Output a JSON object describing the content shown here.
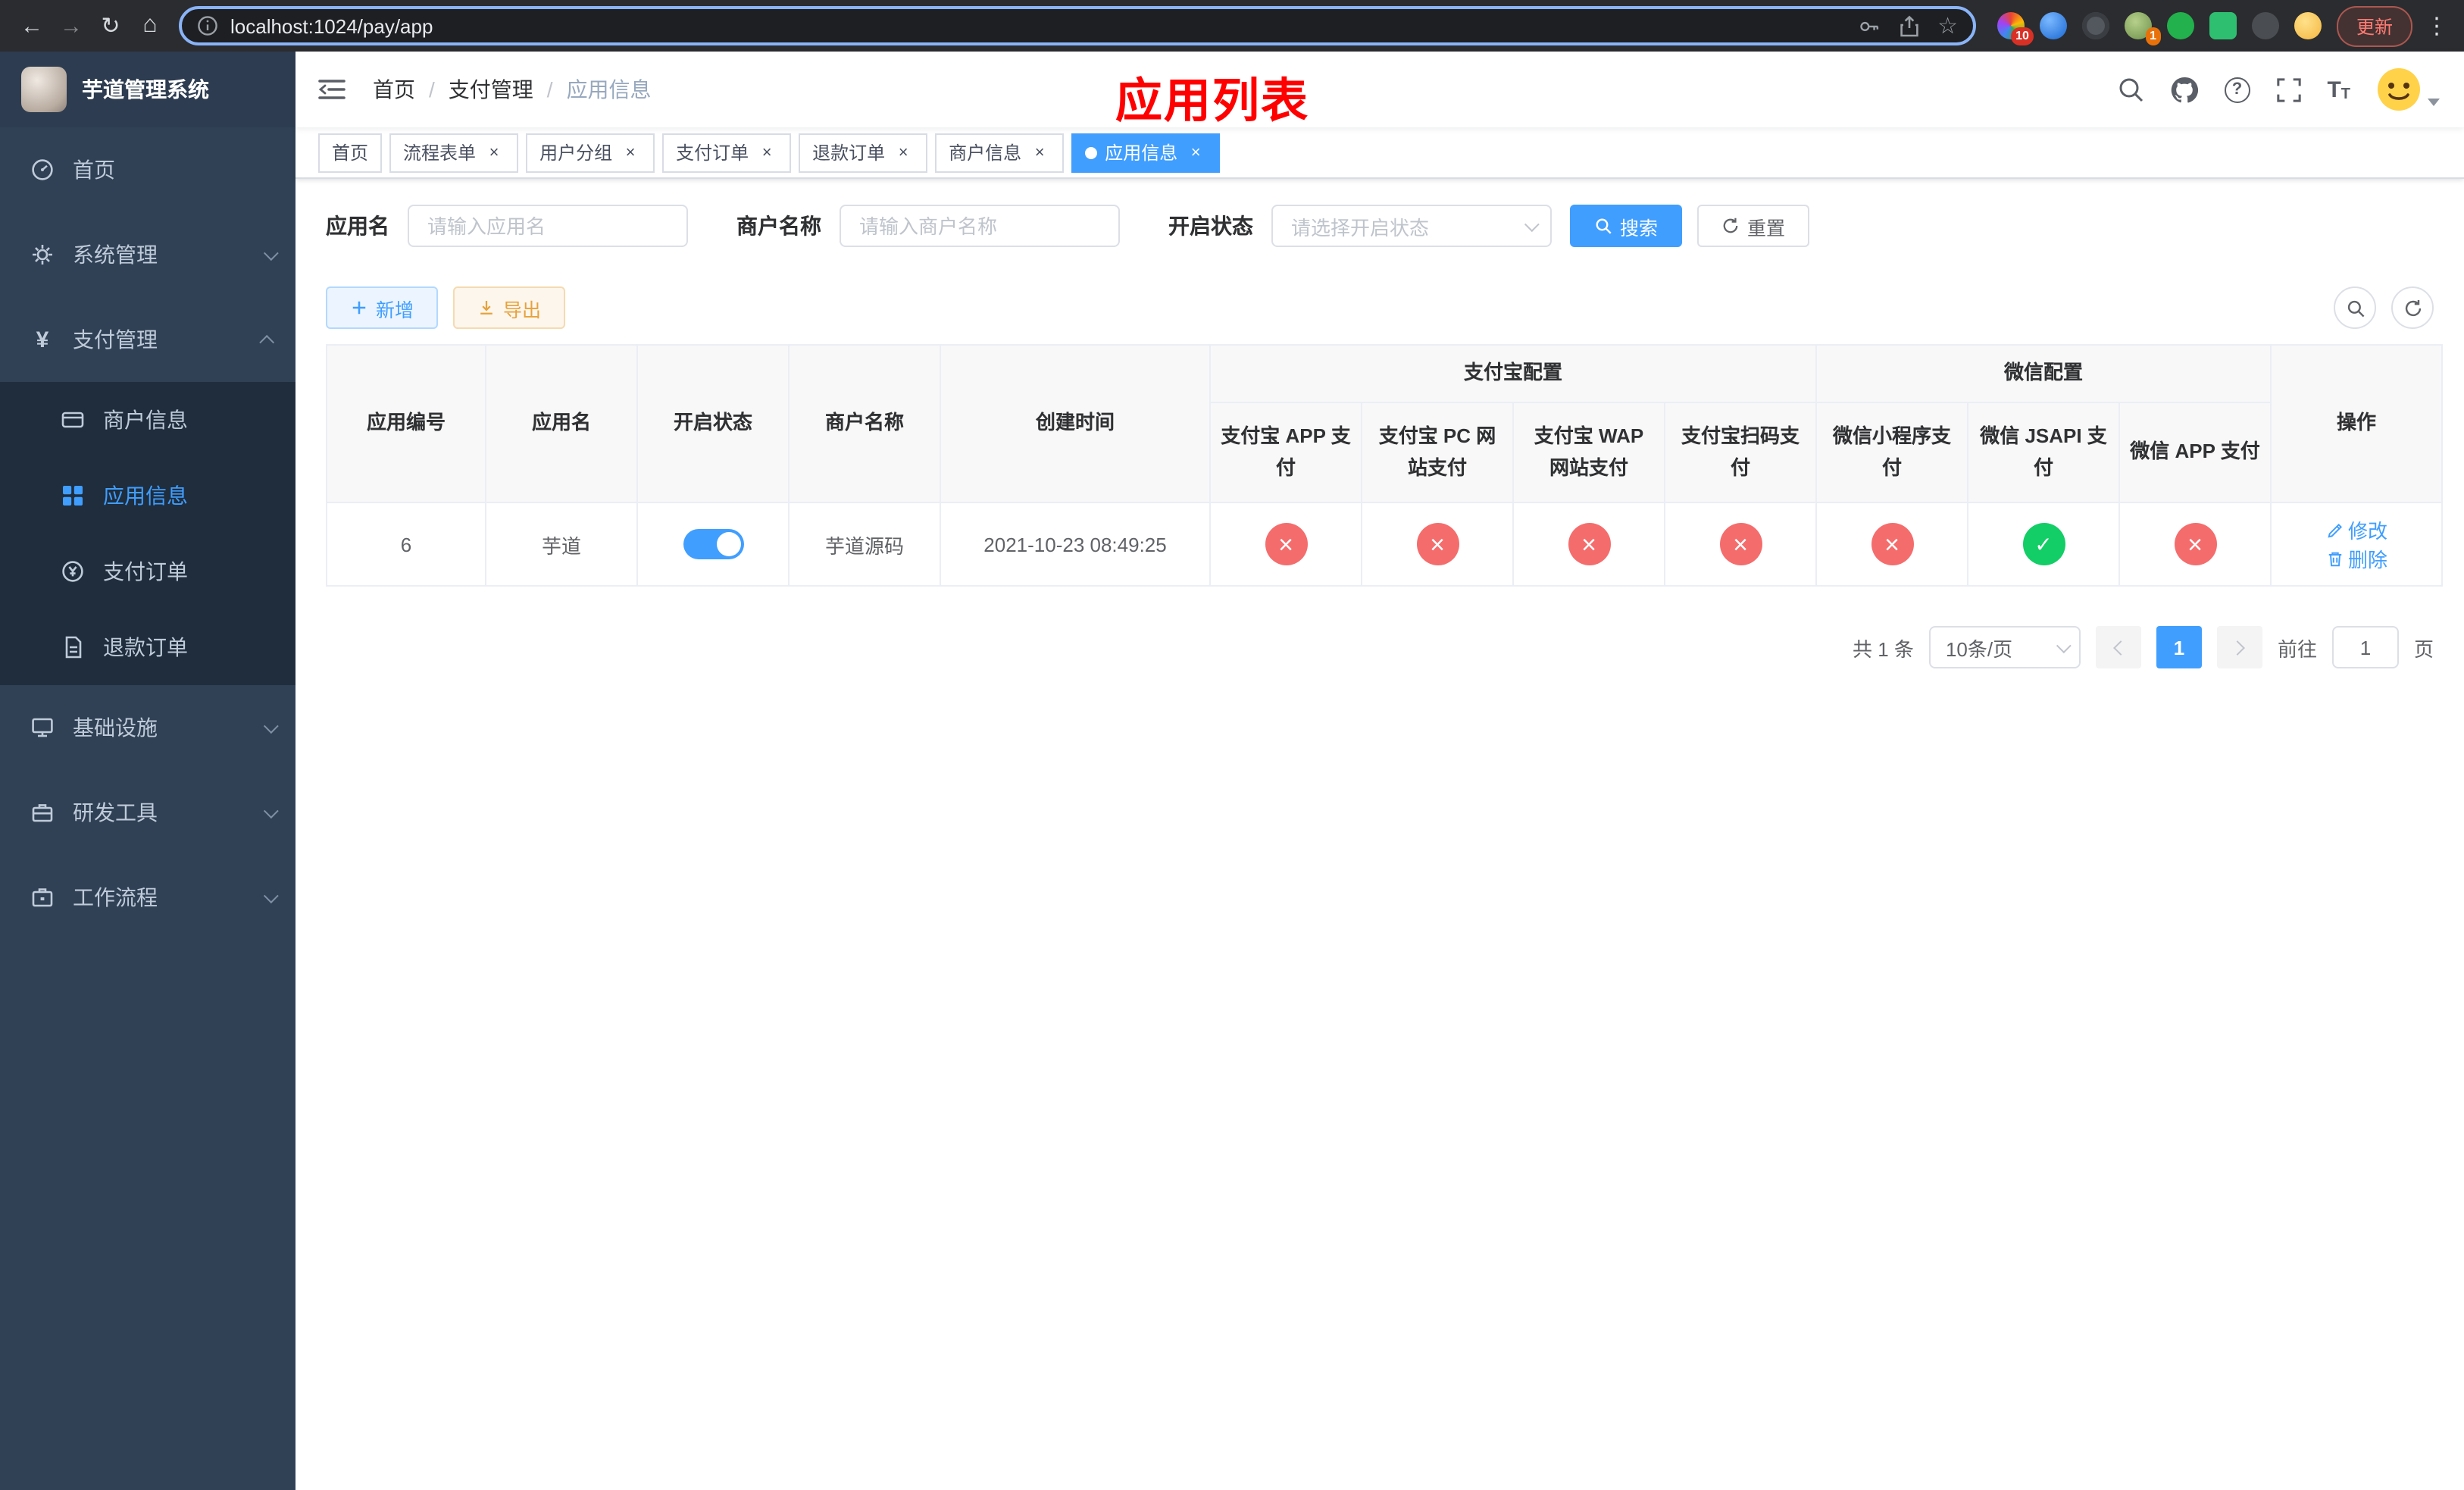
{
  "browser": {
    "url": "localhost:1024/pay/app",
    "update_label": "更新",
    "extension_badges": {
      "first": "10",
      "fourth": "1"
    }
  },
  "sidebar": {
    "title": "芋道管理系统",
    "items": [
      {
        "label": "首页"
      },
      {
        "label": "系统管理"
      },
      {
        "label": "支付管理"
      },
      {
        "label": "基础设施"
      },
      {
        "label": "研发工具"
      },
      {
        "label": "工作流程"
      }
    ],
    "pay_submenu": [
      {
        "label": "商户信息",
        "active": false
      },
      {
        "label": "应用信息",
        "active": true
      },
      {
        "label": "支付订单",
        "active": false
      },
      {
        "label": "退款订单",
        "active": false
      }
    ]
  },
  "header": {
    "breadcrumb": [
      "首页",
      "支付管理",
      "应用信息"
    ],
    "page_title": "应用列表"
  },
  "tabs": [
    {
      "label": "首页",
      "closable": false,
      "active": false
    },
    {
      "label": "流程表单",
      "closable": true,
      "active": false
    },
    {
      "label": "用户分组",
      "closable": true,
      "active": false
    },
    {
      "label": "支付订单",
      "closable": true,
      "active": false
    },
    {
      "label": "退款订单",
      "closable": true,
      "active": false
    },
    {
      "label": "商户信息",
      "closable": true,
      "active": false
    },
    {
      "label": "应用信息",
      "closable": true,
      "active": true
    }
  ],
  "filters": {
    "app_name_label": "应用名",
    "app_name_placeholder": "请输入应用名",
    "merchant_label": "商户名称",
    "merchant_placeholder": "请输入商户名称",
    "status_label": "开启状态",
    "status_placeholder": "请选择开启状态",
    "search_label": "搜索",
    "reset_label": "重置"
  },
  "toolbar": {
    "add_label": "新增",
    "export_label": "导出"
  },
  "table": {
    "columns": {
      "id": "应用编号",
      "name": "应用名",
      "status": "开启状态",
      "merchant": "商户名称",
      "created": "创建时间",
      "alipay_group": "支付宝配置",
      "wechat_group": "微信配置",
      "op": "操作"
    },
    "sub_columns": [
      "支付宝 APP 支付",
      "支付宝 PC 网站支付",
      "支付宝 WAP 网站支付",
      "支付宝扫码支付",
      "微信小程序支付",
      "微信 JSAPI 支付",
      "微信 APP 支付"
    ],
    "rows": [
      {
        "id": "6",
        "name": "芋道",
        "enabled": true,
        "merchant": "芋道源码",
        "created": "2021-10-23 08:49:25",
        "pay_statuses": [
          "fail",
          "fail",
          "fail",
          "fail",
          "fail",
          "success",
          "fail"
        ],
        "edit_label": "修改",
        "delete_label": "删除"
      }
    ]
  },
  "pagination": {
    "total_text": "共 1 条",
    "page_size_text": "10条/页",
    "current_page": "1",
    "goto_label": "前往",
    "goto_value": "1",
    "page_unit": "页"
  },
  "colors": {
    "accent": "#409EFF",
    "success": "#13CE66",
    "danger": "#F56C6C",
    "warning": "#E6A23C",
    "sidebar_bg": "#304156",
    "submenu_bg": "#1F2D3D",
    "title_red": "#FE0000"
  }
}
